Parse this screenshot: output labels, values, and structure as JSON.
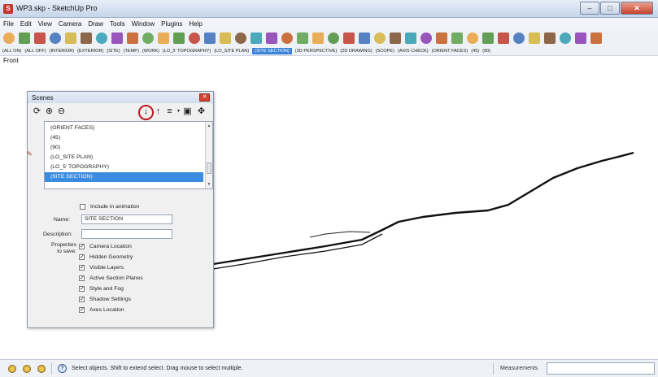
{
  "window": {
    "title": "WP3.skp - SketchUp Pro",
    "buttons": {
      "minimize": "–",
      "maximize": "□",
      "close": "✕"
    }
  },
  "menu": [
    "File",
    "Edit",
    "View",
    "Camera",
    "Draw",
    "Tools",
    "Window",
    "Plugins",
    "Help"
  ],
  "toolbar": {
    "tools": [
      "select-icon",
      "eraser-icon",
      "paint-bucket-icon",
      "push-pull-icon",
      "rectangle-icon",
      "line-icon",
      "circle-icon",
      "arc-icon",
      "offset-icon",
      "follow-me-icon",
      "move-icon",
      "rotate-icon",
      "scale-icon",
      "orbit-icon",
      "pan-icon",
      "zoom-icon",
      "zoom-window-icon",
      "zoom-extents-icon",
      "walk-icon",
      "look-around-icon",
      "position-camera-icon",
      "section-plane-icon",
      "tape-measure-icon",
      "protractor-icon",
      "axes-icon",
      "dimension-icon",
      "text-icon",
      "3d-text-icon",
      "components-icon",
      "materials-icon",
      "styles-icon",
      "layers-icon",
      "scenes-icon",
      "shadows-icon",
      "fog-icon",
      "sandbox-icon",
      "geo-location-icon",
      "warehouse-icon",
      "extension-icon"
    ]
  },
  "scene_tabs": {
    "items": [
      "(ALL ON)",
      "(ALL OFF)",
      "(INTERIOR)",
      "(EXTERIOR)",
      "(SITE)",
      "(TEMP)",
      "(WORK)",
      "(LO_5' TOPOGRAPHY)",
      "(LO_SITE PLAN)",
      "(SITE SECTION)",
      "(3D PERSPECTIVE)",
      "(2D DRAWING)",
      "(SCOPE)",
      "(AXIS CHECK)",
      "(ORIENT FACES)",
      "(45)",
      "(90)"
    ],
    "active": "(SITE SECTION)"
  },
  "viewport": {
    "view_name": "Front"
  },
  "scenes_panel": {
    "title": "Scenes",
    "list": [
      "(ORIENT FACES)",
      "(45)",
      "(90)",
      "(LO_SITE PLAN)",
      "(LO_5' TOPOGRAPHY)",
      "(SITE SECTION)"
    ],
    "selected": "(SITE SECTION)",
    "include_in_animation_label": "Include in animation",
    "include_in_animation_checked": false,
    "name_label": "Name:",
    "name_value": "SITE SECTION",
    "description_label": "Description:",
    "description_value": "",
    "properties_label_1": "Properties",
    "properties_label_2": "to save:",
    "properties": [
      {
        "label": "Camera Location",
        "checked": true
      },
      {
        "label": "Hidden Geometry",
        "checked": true
      },
      {
        "label": "Visible Layers",
        "checked": true
      },
      {
        "label": "Active Section Planes",
        "checked": true
      },
      {
        "label": "Style and Fog",
        "checked": true
      },
      {
        "label": "Shadow Settings",
        "checked": true
      },
      {
        "label": "Axes Location",
        "checked": true
      }
    ]
  },
  "status_bar": {
    "message": "Select objects. Shift to extend select. Drag mouse to select multiple.",
    "measurements_label": "Measurements",
    "measurements_value": ""
  }
}
